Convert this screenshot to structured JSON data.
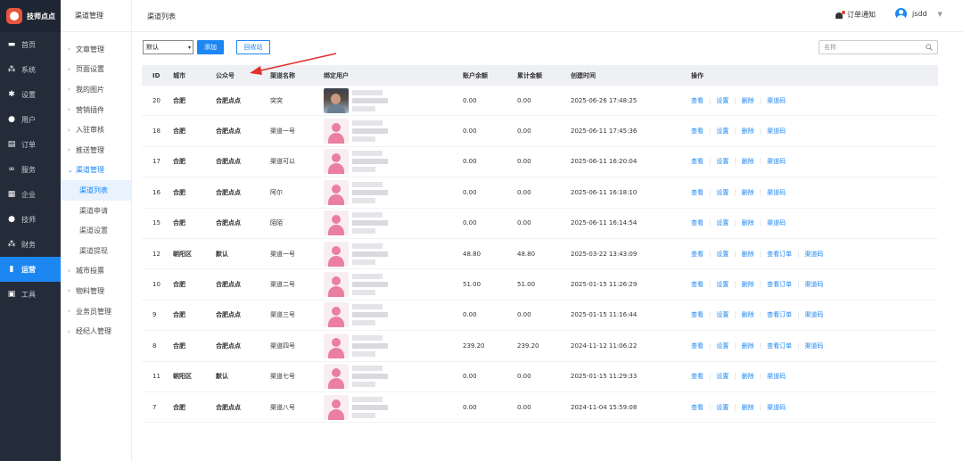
{
  "brand": {
    "name": "技师点点",
    "color": "#e8553e"
  },
  "accent": "#1c87f3",
  "sidebar": {
    "items": [
      {
        "label": "首页",
        "icon": "monitor-icon",
        "glyph": "▬"
      },
      {
        "label": "系统",
        "icon": "sitemap-icon",
        "glyph": "⁂"
      },
      {
        "label": "设置",
        "icon": "gear-icon",
        "glyph": "✱"
      },
      {
        "label": "用户",
        "icon": "user-icon",
        "glyph": "●"
      },
      {
        "label": "订单",
        "icon": "clipboard-icon",
        "glyph": "▤"
      },
      {
        "label": "服务",
        "icon": "link-icon",
        "glyph": "∞"
      },
      {
        "label": "企业",
        "icon": "database-icon",
        "glyph": "▦"
      },
      {
        "label": "技师",
        "icon": "person-icon",
        "glyph": "●"
      },
      {
        "label": "财务",
        "icon": "sitemap-icon",
        "glyph": "⁂"
      },
      {
        "label": "运营",
        "icon": "chart-icon",
        "glyph": "▮",
        "active": true
      },
      {
        "label": "工具",
        "icon": "briefcase-icon",
        "glyph": "▣"
      }
    ]
  },
  "subnav": {
    "title": "渠道管理",
    "items": [
      {
        "label": "文章管理"
      },
      {
        "label": "页面设置"
      },
      {
        "label": "我的图片"
      },
      {
        "label": "营销插件"
      },
      {
        "label": "入驻审核"
      },
      {
        "label": "推送管理"
      },
      {
        "label": "渠道管理",
        "open": true,
        "children": [
          "渠道列表",
          "渠道申请",
          "渠道设置",
          "渠道提现"
        ]
      },
      {
        "label": "城市投票"
      },
      {
        "label": "物料管理"
      },
      {
        "label": "业务员管理"
      },
      {
        "label": "经纪人管理"
      }
    ],
    "active_child": "渠道列表"
  },
  "header": {
    "breadcrumb": "渠道列表",
    "notify_label": "订单通知",
    "username": "jsdd"
  },
  "toolbar": {
    "select_value": "默认",
    "add_label": "添加",
    "recycle_label": "回收站",
    "search_placeholder": "名称"
  },
  "table": {
    "columns": [
      "ID",
      "城市",
      "公众号",
      "渠道名称",
      "绑定用户",
      "账户余额",
      "累计金额",
      "创建时间",
      "操作"
    ],
    "rows": [
      {
        "id": "20",
        "city": "合肥",
        "pub": "合肥点点",
        "name": "突突",
        "avatar": "photo",
        "balance": "0.00",
        "total": "0.00",
        "time": "2025-06-26 17:48:25",
        "ops": [
          "查看",
          "设置",
          "删除",
          "渠道码"
        ]
      },
      {
        "id": "18",
        "city": "合肥",
        "pub": "合肥点点",
        "name": "渠道一号",
        "avatar": "default",
        "balance": "0.00",
        "total": "0.00",
        "time": "2025-06-11 17:45:36",
        "ops": [
          "查看",
          "设置",
          "删除",
          "渠道码"
        ]
      },
      {
        "id": "17",
        "city": "合肥",
        "pub": "合肥点点",
        "name": "渠道可以",
        "avatar": "default",
        "balance": "0.00",
        "total": "0.00",
        "time": "2025-06-11 16:20:04",
        "ops": [
          "查看",
          "设置",
          "删除",
          "渠道码"
        ]
      },
      {
        "id": "16",
        "city": "合肥",
        "pub": "合肥点点",
        "name": "阿尔",
        "avatar": "default",
        "balance": "0.00",
        "total": "0.00",
        "time": "2025-06-11 16:18:10",
        "ops": [
          "查看",
          "设置",
          "删除",
          "渠道码"
        ]
      },
      {
        "id": "15",
        "city": "合肥",
        "pub": "合肥点点",
        "name": "陌陌",
        "avatar": "default",
        "balance": "0.00",
        "total": "0.00",
        "time": "2025-06-11 16:14:54",
        "ops": [
          "查看",
          "设置",
          "删除",
          "渠道码"
        ]
      },
      {
        "id": "12",
        "city": "朝阳区",
        "pub": "默认",
        "name": "渠道一号",
        "avatar": "default",
        "balance": "48.80",
        "total": "48.80",
        "time": "2025-03-22 13:43:09",
        "ops": [
          "查看",
          "设置",
          "删除",
          "查看订单",
          "渠道码"
        ]
      },
      {
        "id": "10",
        "city": "合肥",
        "pub": "合肥点点",
        "name": "渠道二号",
        "avatar": "default",
        "balance": "51.00",
        "total": "51.00",
        "time": "2025-01-15 11:26:29",
        "ops": [
          "查看",
          "设置",
          "删除",
          "查看订单",
          "渠道码"
        ]
      },
      {
        "id": "9",
        "city": "合肥",
        "pub": "合肥点点",
        "name": "渠道三号",
        "avatar": "default",
        "balance": "0.00",
        "total": "0.00",
        "time": "2025-01-15 11:16:44",
        "ops": [
          "查看",
          "设置",
          "删除",
          "查看订单",
          "渠道码"
        ]
      },
      {
        "id": "8",
        "city": "合肥",
        "pub": "合肥点点",
        "name": "渠道四号",
        "avatar": "default",
        "balance": "239.20",
        "total": "239.20",
        "time": "2024-11-12 11:06:22",
        "ops": [
          "查看",
          "设置",
          "删除",
          "查看订单",
          "渠道码"
        ]
      },
      {
        "id": "11",
        "city": "朝阳区",
        "pub": "默认",
        "name": "渠道七号",
        "avatar": "default",
        "balance": "0.00",
        "total": "0.00",
        "time": "2025-01-15 11:29:33",
        "ops": [
          "查看",
          "设置",
          "删除",
          "渠道码"
        ]
      },
      {
        "id": "7",
        "city": "合肥",
        "pub": "合肥点点",
        "name": "渠道八号",
        "avatar": "default",
        "balance": "0.00",
        "total": "0.00",
        "time": "2024-11-04 15:59:08",
        "ops": [
          "查看",
          "设置",
          "删除",
          "渠道码"
        ]
      }
    ]
  }
}
